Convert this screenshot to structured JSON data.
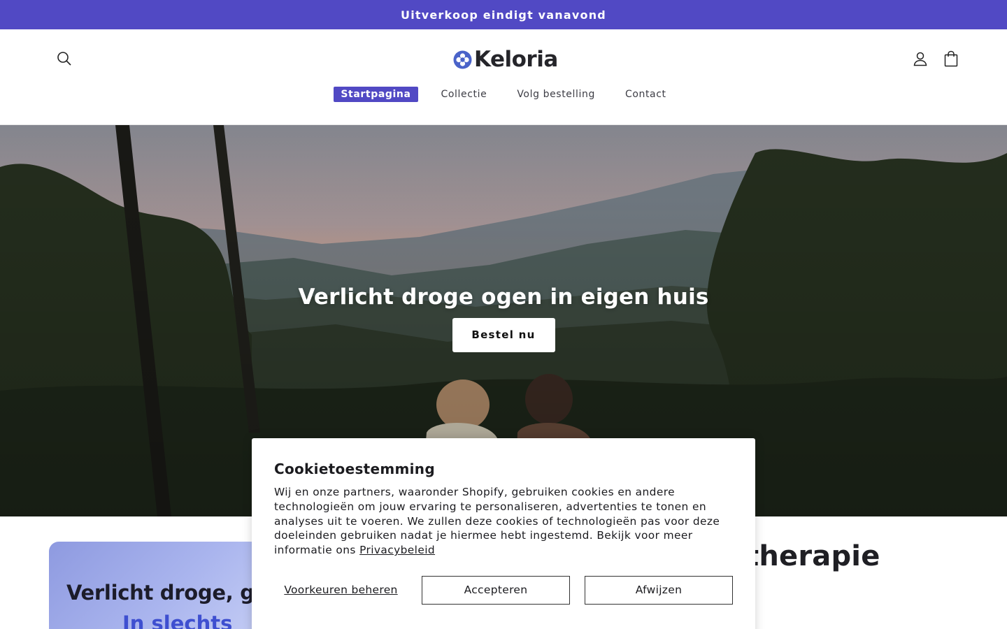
{
  "announcement": {
    "text": "Uitverkoop eindigt vanavond"
  },
  "header": {
    "brand": "Keloria",
    "nav": [
      {
        "label": "Startpagina",
        "active": true
      },
      {
        "label": "Collectie",
        "active": false
      },
      {
        "label": "Volg bestelling",
        "active": false
      },
      {
        "label": "Contact",
        "active": false
      }
    ],
    "icons": {
      "search": "search-icon",
      "account": "account-icon",
      "cart": "cart-icon",
      "logo": "flower-logo-icon"
    }
  },
  "hero": {
    "title": "Verlicht droge ogen in eigen huis",
    "button_label": "Bestel nu",
    "image_description_icon": "landscape-photo"
  },
  "below_fold": {
    "promo_line1": "Verlicht droge, g",
    "promo_line2": "In slechts",
    "product_title_fragment": "therapie"
  },
  "cookie_banner": {
    "title": "Cookietoestemming",
    "text": "Wij en onze partners, waaronder Shopify, gebruiken cookies en andere technologieën om jouw ervaring te personaliseren, advertenties te tonen en analyses uit te voeren. We zullen deze cookies of technologieën pas voor deze doeleinden gebruiken nadat je hiermee hebt ingestemd. Bekijk voor meer informatie ons",
    "privacy_link": "Privacybeleid",
    "manage_label": "Voorkeuren beheren",
    "accept_label": "Accepteren",
    "decline_label": "Afwijzen"
  },
  "colors": {
    "accent": "#5149c4",
    "text": "#1f1f24",
    "promo_blue": "#3e4fd0"
  }
}
